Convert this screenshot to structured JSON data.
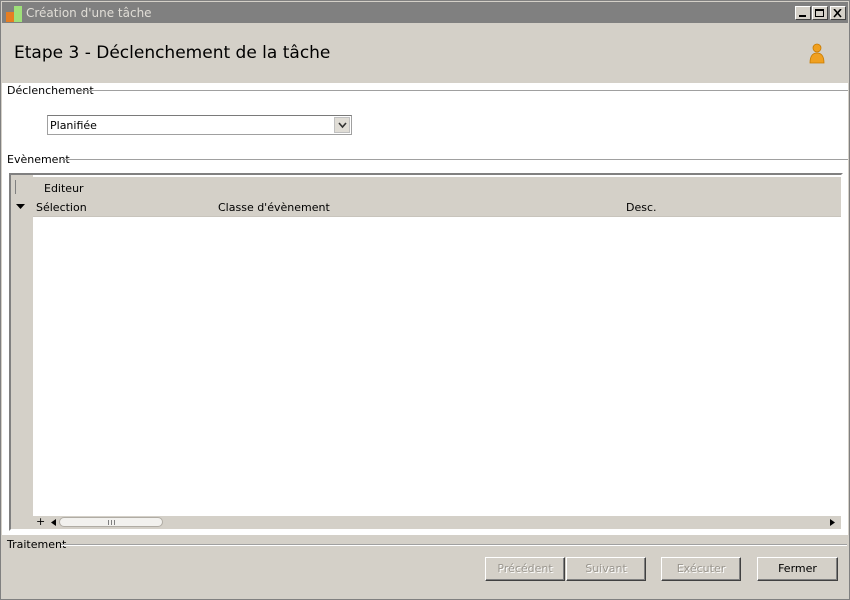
{
  "window": {
    "title": "Création d'une tâche",
    "controls": [
      "minimize-icon",
      "maximize-icon",
      "close-icon"
    ]
  },
  "header": {
    "title": "Etape 3 - Déclenchement de la tâche",
    "icon": "user-icon"
  },
  "trigger_section": {
    "label": "Déclenchement",
    "select_value": "Planifiée"
  },
  "event_section": {
    "label": "Evènement",
    "band_label": "Editeur",
    "columns": [
      "Sélection",
      "Classe d'évènement",
      "Desc."
    ],
    "rows": [],
    "footer_add": "+"
  },
  "processing_section": {
    "label": "Traitement"
  },
  "buttons": {
    "previous": "Précédent",
    "next": "Suivant",
    "execute": "Exécuter",
    "close": "Fermer"
  },
  "colors": {
    "titlebar": "#808080",
    "dialog_bg": "#d4d0c8",
    "content_bg": "#ffffff",
    "user_icon": "#f0a020"
  }
}
